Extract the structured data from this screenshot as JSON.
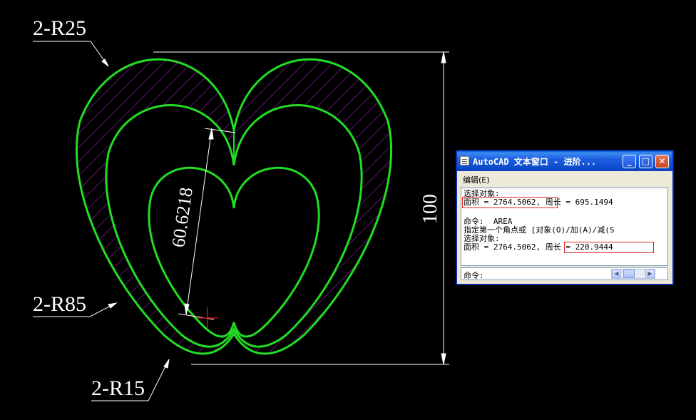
{
  "drawing": {
    "label_r25": "2-R25",
    "label_r85": "2-R85",
    "label_r15": "2-R15",
    "dim_height": "100",
    "dim_diagonal": "60.6218",
    "colors": {
      "outline": "#22dd22",
      "hatch": "#a020c0",
      "dimension": "#ffffff",
      "cursor": "#cc1111"
    }
  },
  "text_window": {
    "title": "AutoCAD 文本窗口 - 进阶...",
    "buttons": {
      "minimize": "_",
      "maximize": "□",
      "close": "✕"
    },
    "menu": {
      "edit": "编辑(E)"
    },
    "lines": [
      "选择对象:",
      "面积 = 2764.5062, 周长 = 695.1494",
      "",
      "命令:  AREA",
      "指定第一个角点或 [对象(O)/加(A)/减(S",
      "选择对象:",
      "面积 = 2764.5062, 周长 = 220.9444"
    ],
    "prompt": "命令:"
  }
}
